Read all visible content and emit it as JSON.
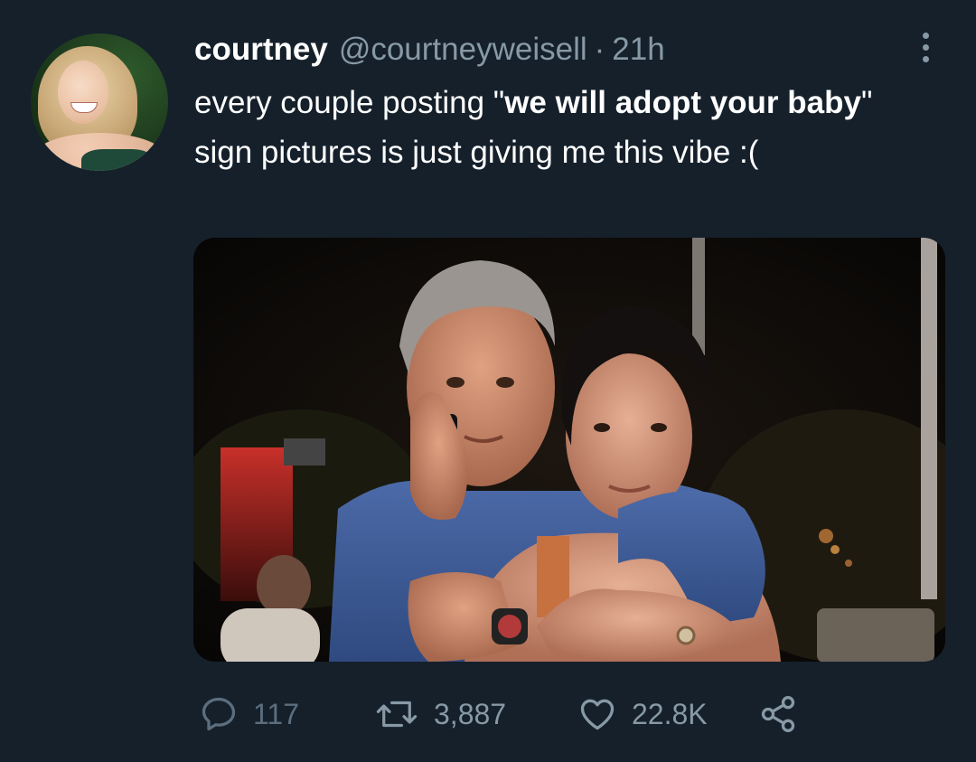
{
  "tweet": {
    "display_name": "courtney",
    "handle": "@courtneyweisell",
    "separator": "·",
    "time": "21h",
    "text_part1": "every couple posting \"",
    "text_bold": "we will adopt your baby",
    "text_part2": "\" sign pictures is just giving me this vibe :("
  },
  "actions": {
    "replies": "117",
    "retweets": "3,887",
    "likes": "22.8K"
  },
  "icons": {
    "more": "more-icon",
    "reply": "reply-icon",
    "retweet": "retweet-icon",
    "like": "heart-icon",
    "share": "share-icon"
  },
  "colors": {
    "background": "#15202b",
    "secondary_text": "#8899a6",
    "primary_text": "#ffffff"
  }
}
